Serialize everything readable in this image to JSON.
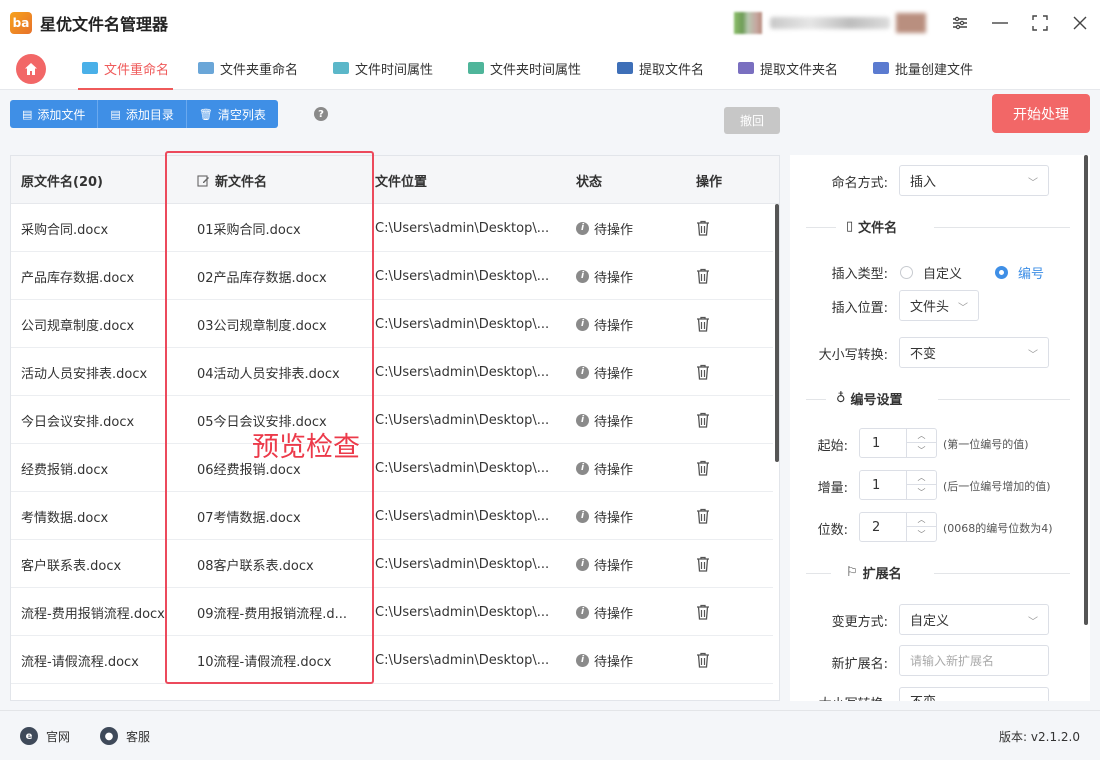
{
  "app": {
    "title": "星优文件名管理器",
    "logo_text": "ba"
  },
  "tabs": [
    {
      "label": "文件重命名",
      "active": true
    },
    {
      "label": "文件夹重命名"
    },
    {
      "label": "文件时间属性"
    },
    {
      "label": "文件夹时间属性"
    },
    {
      "label": "提取文件名"
    },
    {
      "label": "提取文件夹名"
    },
    {
      "label": "批量创建文件"
    }
  ],
  "toolbar": {
    "add_file": "添加文件",
    "add_dir": "添加目录",
    "clear_list": "清空列表",
    "help": "?",
    "undo": "撤回",
    "start": "开始处理"
  },
  "table": {
    "headers": {
      "original": "原文件名(20)",
      "new": "新文件名",
      "location": "文件位置",
      "status": "状态",
      "action": "操作"
    },
    "rows": [
      {
        "original": "采购合同.docx",
        "new": "01采购合同.docx",
        "location": "C:\\Users\\admin\\Desktop\\...",
        "status": "待操作"
      },
      {
        "original": "产品库存数据.docx",
        "new": "02产品库存数据.docx",
        "location": "C:\\Users\\admin\\Desktop\\...",
        "status": "待操作"
      },
      {
        "original": "公司规章制度.docx",
        "new": "03公司规章制度.docx",
        "location": "C:\\Users\\admin\\Desktop\\...",
        "status": "待操作"
      },
      {
        "original": "活动人员安排表.docx",
        "new": "04活动人员安排表.docx",
        "location": "C:\\Users\\admin\\Desktop\\...",
        "status": "待操作"
      },
      {
        "original": "今日会议安排.docx",
        "new": "05今日会议安排.docx",
        "location": "C:\\Users\\admin\\Desktop\\...",
        "status": "待操作"
      },
      {
        "original": "经费报销.docx",
        "new": "06经费报销.docx",
        "location": "C:\\Users\\admin\\Desktop\\...",
        "status": "待操作"
      },
      {
        "original": "考情数据.docx",
        "new": "07考情数据.docx",
        "location": "C:\\Users\\admin\\Desktop\\...",
        "status": "待操作"
      },
      {
        "original": "客户联系表.docx",
        "new": "08客户联系表.docx",
        "location": "C:\\Users\\admin\\Desktop\\...",
        "status": "待操作"
      },
      {
        "original": "流程-费用报销流程.docx",
        "new": "09流程-费用报销流程.d...",
        "location": "C:\\Users\\admin\\Desktop\\...",
        "status": "待操作"
      },
      {
        "original": "流程-请假流程.docx",
        "new": "10流程-请假流程.docx",
        "location": "C:\\Users\\admin\\Desktop\\...",
        "status": "待操作"
      }
    ]
  },
  "annotation": "预览检查",
  "panel": {
    "naming_mode_label": "命名方式:",
    "naming_mode_value": "插入",
    "filename_section": "文件名",
    "insert_type_label": "插入类型:",
    "insert_type_options": [
      "自定义",
      "编号"
    ],
    "insert_type_selected": "编号",
    "insert_pos_label": "插入位置:",
    "insert_pos_value": "文件头",
    "case_label": "大小写转换:",
    "case_value": "不变",
    "numbering_section": "编号设置",
    "start_label": "起始:",
    "start_value": "1",
    "start_hint": "(第一位编号的值)",
    "step_label": "增量:",
    "step_value": "1",
    "step_hint": "(后一位编号增加的值)",
    "digits_label": "位数:",
    "digits_value": "2",
    "digits_hint": "(0068的编号位数为4)",
    "ext_section": "扩展名",
    "ext_mode_label": "变更方式:",
    "ext_mode_value": "自定义",
    "new_ext_label": "新扩展名:",
    "new_ext_placeholder": "请输入新扩展名",
    "ext_case_label": "大小写转换:",
    "ext_case_value": "不变"
  },
  "footer": {
    "website": "官网",
    "support": "客服",
    "version": "版本: v2.1.2.0"
  },
  "colors": {
    "accent": "#ef5a5a",
    "primary": "#3f8fe6",
    "highlight": "#ec4a5c"
  }
}
